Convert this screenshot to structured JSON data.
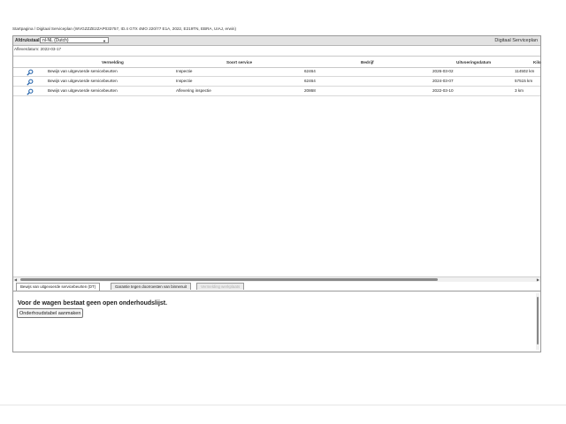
{
  "breadcrumb": "Startpagina / Digitaal Serviceplan (WVGZZZE2ZAP033757, ID.4 GTX 4MO 220/77 E1A, 2022, E219TN, EBRA, UIAJ, erwin)",
  "topbar": {
    "lang_label": "Afdrukstaal:",
    "lang_value": "nl-NL (Dutch)",
    "plan_title": "Digitaal Serviceplan"
  },
  "delivery_date": "Afleverdatum: 2022-03-17",
  "table": {
    "headers": [
      "Vermelding",
      "Soort service",
      "Bedrijf",
      "Uitvoeringsdatum",
      "Kilo"
    ],
    "rows": [
      {
        "vermelding": "Bewijs van uitgevoerde servicebeurten",
        "soort": "Inspectie",
        "nummer": "62464",
        "datum": "2026-03-02",
        "km": "114502 km"
      },
      {
        "vermelding": "Bewijs van uitgevoerde servicebeurten",
        "soort": "Inspectie",
        "nummer": "62464",
        "datum": "2024-03-07",
        "km": "57515 km"
      },
      {
        "vermelding": "Bewijs van uitgevoerde servicebeurten",
        "soort": "Aflevering inspectie",
        "nummer": "20868",
        "datum": "2022-03-10",
        "km": "3 km"
      }
    ]
  },
  "tabs": [
    {
      "label": "Bewijs van uitgevoerde servicebeurten (DT)",
      "state": "active"
    },
    {
      "label": "Garantie tegen doorroesten van binnenuit",
      "state": "normal"
    },
    {
      "label": "Vermelding werkplaats",
      "state": "disabled"
    }
  ],
  "panel": {
    "message": "Voor de wagen bestaat geen open onderhoudslijst.",
    "button_label": "Onderhoudstabel aanmaken"
  },
  "icons": {
    "row_action": "magnifier-icon"
  },
  "colors": {
    "icon_blue": "#1f5fa8",
    "topbar_gray": "#e2e2e2"
  }
}
